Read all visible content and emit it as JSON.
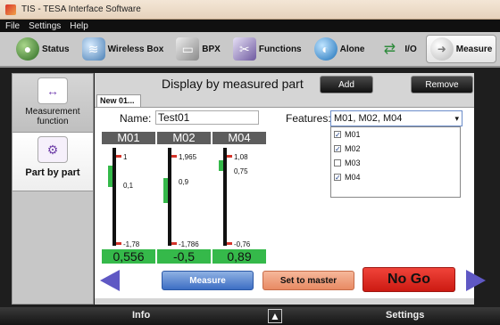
{
  "window": {
    "title": "TIS - TESA Interface Software"
  },
  "menu": {
    "items": [
      "File",
      "Settings",
      "Help"
    ]
  },
  "toolbar": {
    "tabs": [
      {
        "label": "Status",
        "icon": "status-icon"
      },
      {
        "label": "Wireless Box",
        "icon": "wireless-icon"
      },
      {
        "label": "BPX",
        "icon": "bpx-icon"
      },
      {
        "label": "Functions",
        "icon": "functions-icon"
      },
      {
        "label": "Alone",
        "icon": "alone-icon"
      },
      {
        "label": "I/O",
        "icon": "io-arrows-icon"
      },
      {
        "label": "Measure",
        "icon": "measure-icon"
      }
    ],
    "active": "Measure"
  },
  "sidebar": {
    "items": [
      {
        "label": "Measurement function",
        "icon": "measurement-function-icon"
      },
      {
        "label": "Part by part",
        "icon": "part-by-part-icon",
        "active": true
      }
    ]
  },
  "main": {
    "title": "Display by measured part",
    "add_label": "Add",
    "remove_label": "Remove",
    "subtab": "New 01...",
    "name_label": "Name:",
    "name_value": "Test01",
    "features_label": "Features:",
    "features_value": "M01, M02, M04",
    "feature_options": [
      {
        "label": "M01",
        "checked": true
      },
      {
        "label": "M02",
        "checked": true
      },
      {
        "label": "M03",
        "checked": false
      },
      {
        "label": "M04",
        "checked": true
      }
    ],
    "gauges": [
      {
        "name": "M01",
        "upper": "1",
        "mid": "0,1",
        "lower": "-1,78",
        "value": "0,556"
      },
      {
        "name": "M02",
        "upper": "1,965",
        "mid": "0,9",
        "lower": "-1,786",
        "value": "-0,5"
      },
      {
        "name": "M04",
        "upper": "1,08",
        "mid": "0,75",
        "lower": "-0,76",
        "value": "0,89"
      }
    ],
    "measure_label": "Measure",
    "set_master_label": "Set to master",
    "result_label": "No Go"
  },
  "status": {
    "info_label": "Info",
    "settings_label": "Settings",
    "up_glyph": "▲"
  }
}
